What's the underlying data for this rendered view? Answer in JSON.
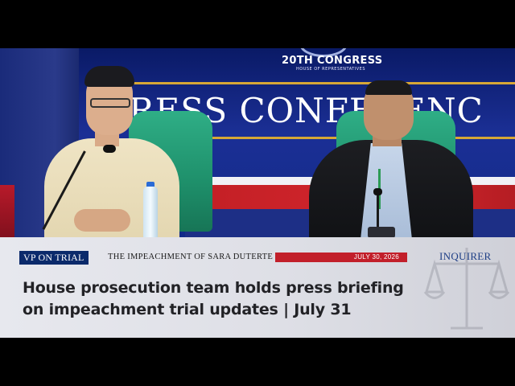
{
  "scene": {
    "congress_heading": "20TH CONGRESS",
    "congress_subheading": "HOUSE OF REPRESENTATIVES",
    "backdrop_banner": "RESS CONFERENC"
  },
  "lower_third": {
    "badge": "VP ON TRIAL",
    "subtitle": "THE IMPEACHMENT OF SARA DUTERTE",
    "date": "JULY 30, 2026",
    "brand": "INQUIRER",
    "headline_line1": "House prosecution team holds press briefing",
    "headline_line2": "on impeachment trial updates | July 31"
  },
  "colors": {
    "badge_bg": "#0b2a6b",
    "date_bar": "#c21f2a",
    "brand": "#1f3f86",
    "backdrop_blue": "#1b2f95",
    "backdrop_red": "#d3262d",
    "chair_green": "#2fae86"
  }
}
